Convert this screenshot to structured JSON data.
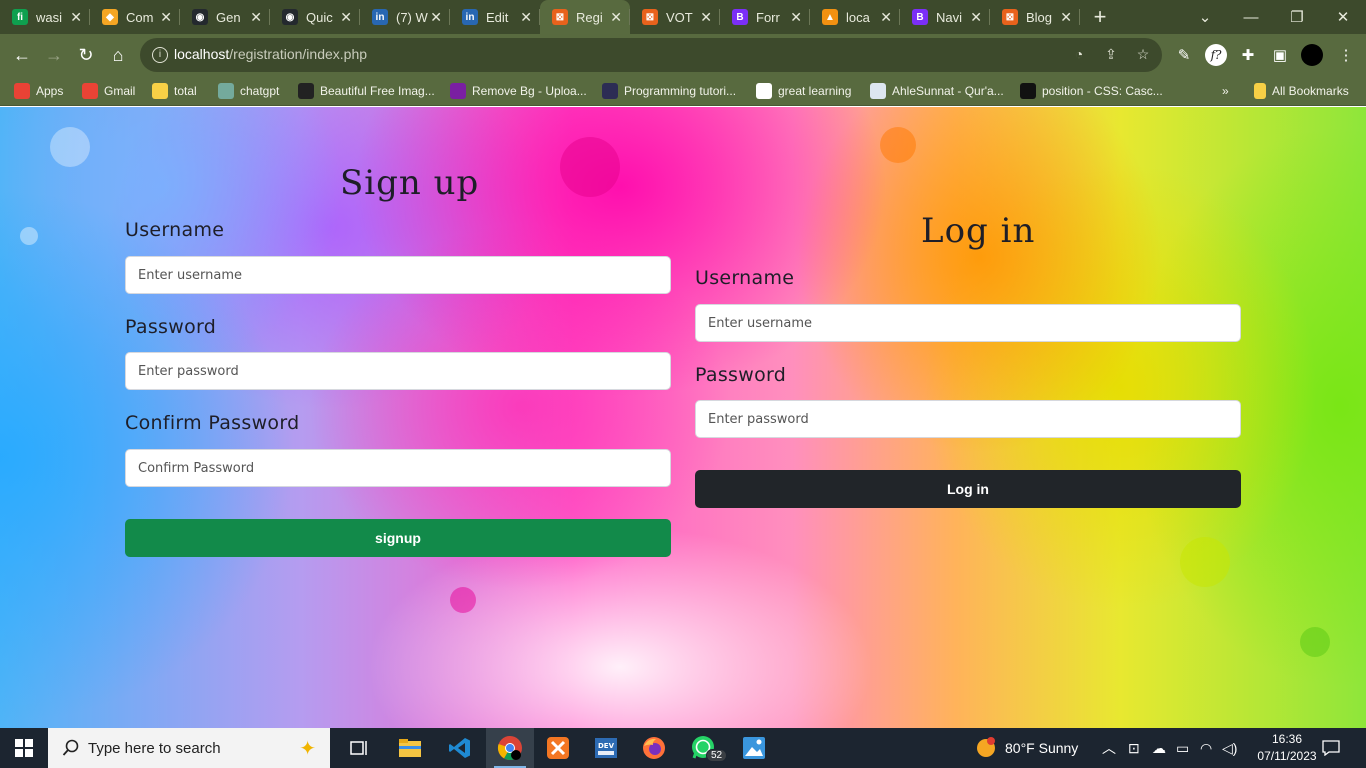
{
  "browser": {
    "tabs": [
      {
        "title": "wasi",
        "color": "#0fa04f",
        "glyph": "fi"
      },
      {
        "title": "Com",
        "color": "#f5a623",
        "glyph": "◆"
      },
      {
        "title": "Gen",
        "color": "#24292e",
        "glyph": "◉"
      },
      {
        "title": "Quic",
        "color": "#24292e",
        "glyph": "◉"
      },
      {
        "title": "(7) W",
        "color": "#2867b2",
        "glyph": "in"
      },
      {
        "title": "Edit",
        "color": "#2867b2",
        "glyph": "in"
      },
      {
        "title": "Regi",
        "color": "#e8621c",
        "glyph": "⊠"
      },
      {
        "title": "VOT",
        "color": "#e8621c",
        "glyph": "⊠"
      },
      {
        "title": "Forr",
        "color": "#7b2ff7",
        "glyph": "B"
      },
      {
        "title": "loca",
        "color": "#f29111",
        "glyph": "▲"
      },
      {
        "title": "Navi",
        "color": "#7b2ff7",
        "glyph": "B"
      },
      {
        "title": "Blog",
        "color": "#e8621c",
        "glyph": "⊠"
      }
    ],
    "active_tab_index": 6,
    "url_host": "localhost",
    "url_path": "/registration/index.php",
    "bookmarks": [
      {
        "label": "Apps",
        "color": "#e94235"
      },
      {
        "label": "Gmail",
        "color": "#ea4335"
      },
      {
        "label": "total",
        "color": "#f7d046"
      },
      {
        "label": "chatgpt",
        "color": "#74aa9c"
      },
      {
        "label": "Beautiful Free Imag...",
        "color": "#222222"
      },
      {
        "label": "Remove Bg - Uploa...",
        "color": "#7a1fa2"
      },
      {
        "label": "Programming tutori...",
        "color": "#2c2c54"
      },
      {
        "label": "great learning",
        "color": "#ffffff"
      },
      {
        "label": "AhleSunnat - Qur'a...",
        "color": "#dde6f0"
      },
      {
        "label": "position - CSS: Casc...",
        "color": "#111111"
      }
    ],
    "all_bookmarks_label": "All Bookmarks"
  },
  "signup": {
    "title": "Sign up",
    "username_label": "Username",
    "username_placeholder": "Enter username",
    "password_label": "Password",
    "password_placeholder": "Enter password",
    "confirm_label": "Confirm Password",
    "confirm_placeholder": "Confirm Password",
    "button_label": "signup"
  },
  "login": {
    "title": "Log in",
    "username_label": "Username",
    "username_placeholder": "Enter username",
    "password_label": "Password",
    "password_placeholder": "Enter password",
    "button_label": "Log in"
  },
  "taskbar": {
    "search_placeholder": "Type here to search",
    "whatsapp_badge": "52",
    "weather": "80°F  Sunny",
    "time": "16:36",
    "date": "07/11/2023"
  }
}
